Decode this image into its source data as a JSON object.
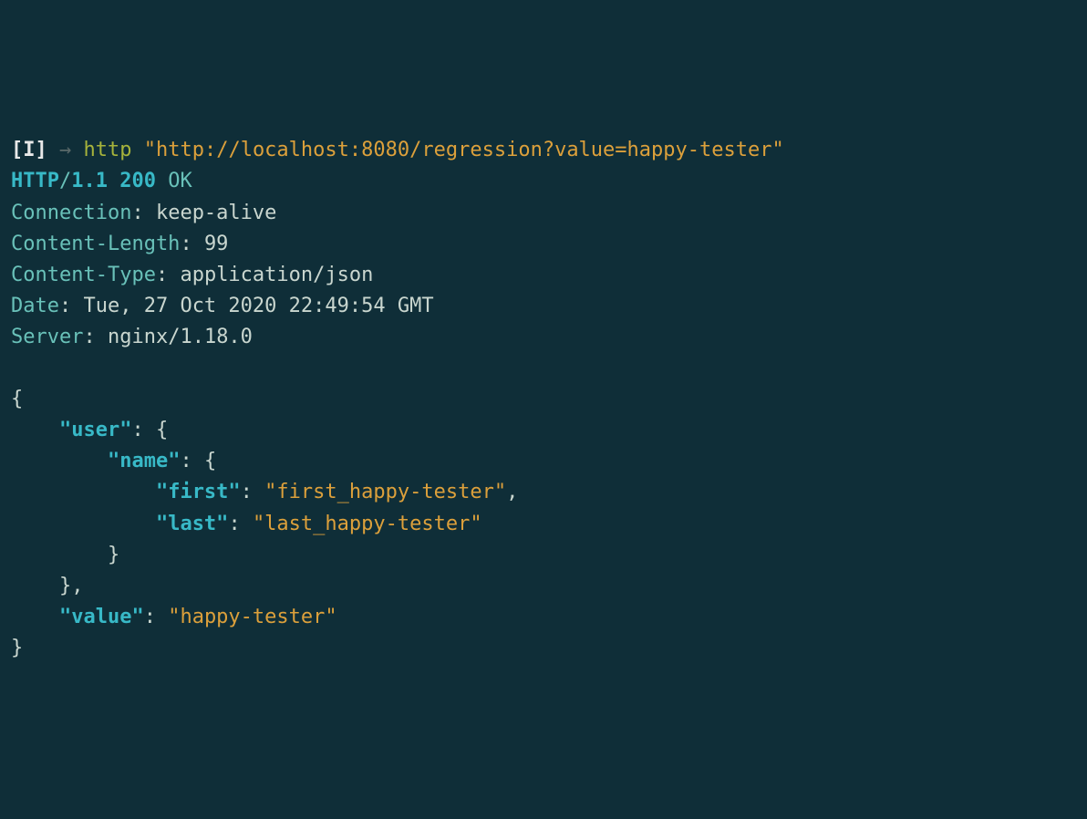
{
  "prompt": {
    "mode": "[I]",
    "arrow": "→",
    "cmd": "http",
    "url": "\"http://localhost:8080/regression?value=happy-tester\""
  },
  "status_line": {
    "protocol": "HTTP",
    "slash": "/",
    "version": "1.1",
    "code": "200",
    "reason": "OK"
  },
  "headers": {
    "connection": {
      "key": "Connection",
      "colon": ": ",
      "value": "keep-alive"
    },
    "content_length": {
      "key": "Content-Length",
      "colon": ": ",
      "value": "99"
    },
    "content_type": {
      "key": "Content-Type",
      "colon": ": ",
      "value": "application/json"
    },
    "date": {
      "key": "Date",
      "colon": ": ",
      "value": "Tue, 27 Oct 2020 22:49:54 GMT"
    },
    "server": {
      "key": "Server",
      "colon": ": ",
      "value": "nginx/1.18.0"
    }
  },
  "body": {
    "open": "{",
    "user_key": "\"user\"",
    "colon_sp": ": ",
    "brace_open": "{",
    "name_key": "\"name\"",
    "first_key": "\"first\"",
    "first_val": "\"first_happy-tester\"",
    "comma": ",",
    "last_key": "\"last\"",
    "last_val": "\"last_happy-tester\"",
    "brace_close": "}",
    "brace_close_comma": "},",
    "value_key": "\"value\"",
    "value_val": "\"happy-tester\"",
    "close": "}"
  },
  "indent": {
    "i1": "    ",
    "i2": "        ",
    "i3": "            "
  }
}
